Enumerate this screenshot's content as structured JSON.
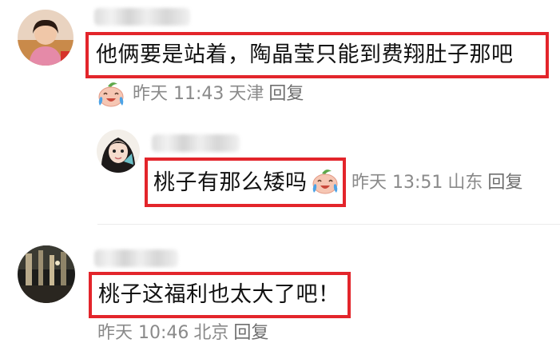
{
  "comments": [
    {
      "text": "他俩要是站着，陶晶莹只能到费翔肚子那吧",
      "emoji_icon": "crying-laughing-peach-emoji",
      "time": "昨天 11:43",
      "location": "天津",
      "reply_label": "回复"
    },
    {
      "text": "桃子有那么矮吗",
      "emoji_icon": "crying-laughing-peach-emoji",
      "time": "昨天 13:51",
      "location": "山东",
      "reply_label": "回复"
    },
    {
      "text": "桃子这福利也太大了吧！",
      "time": "昨天 10:46",
      "location": "北京",
      "reply_label": "回复"
    }
  ],
  "colors": {
    "highlight_border": "#e3252b",
    "meta_text": "#8a8a8a"
  }
}
